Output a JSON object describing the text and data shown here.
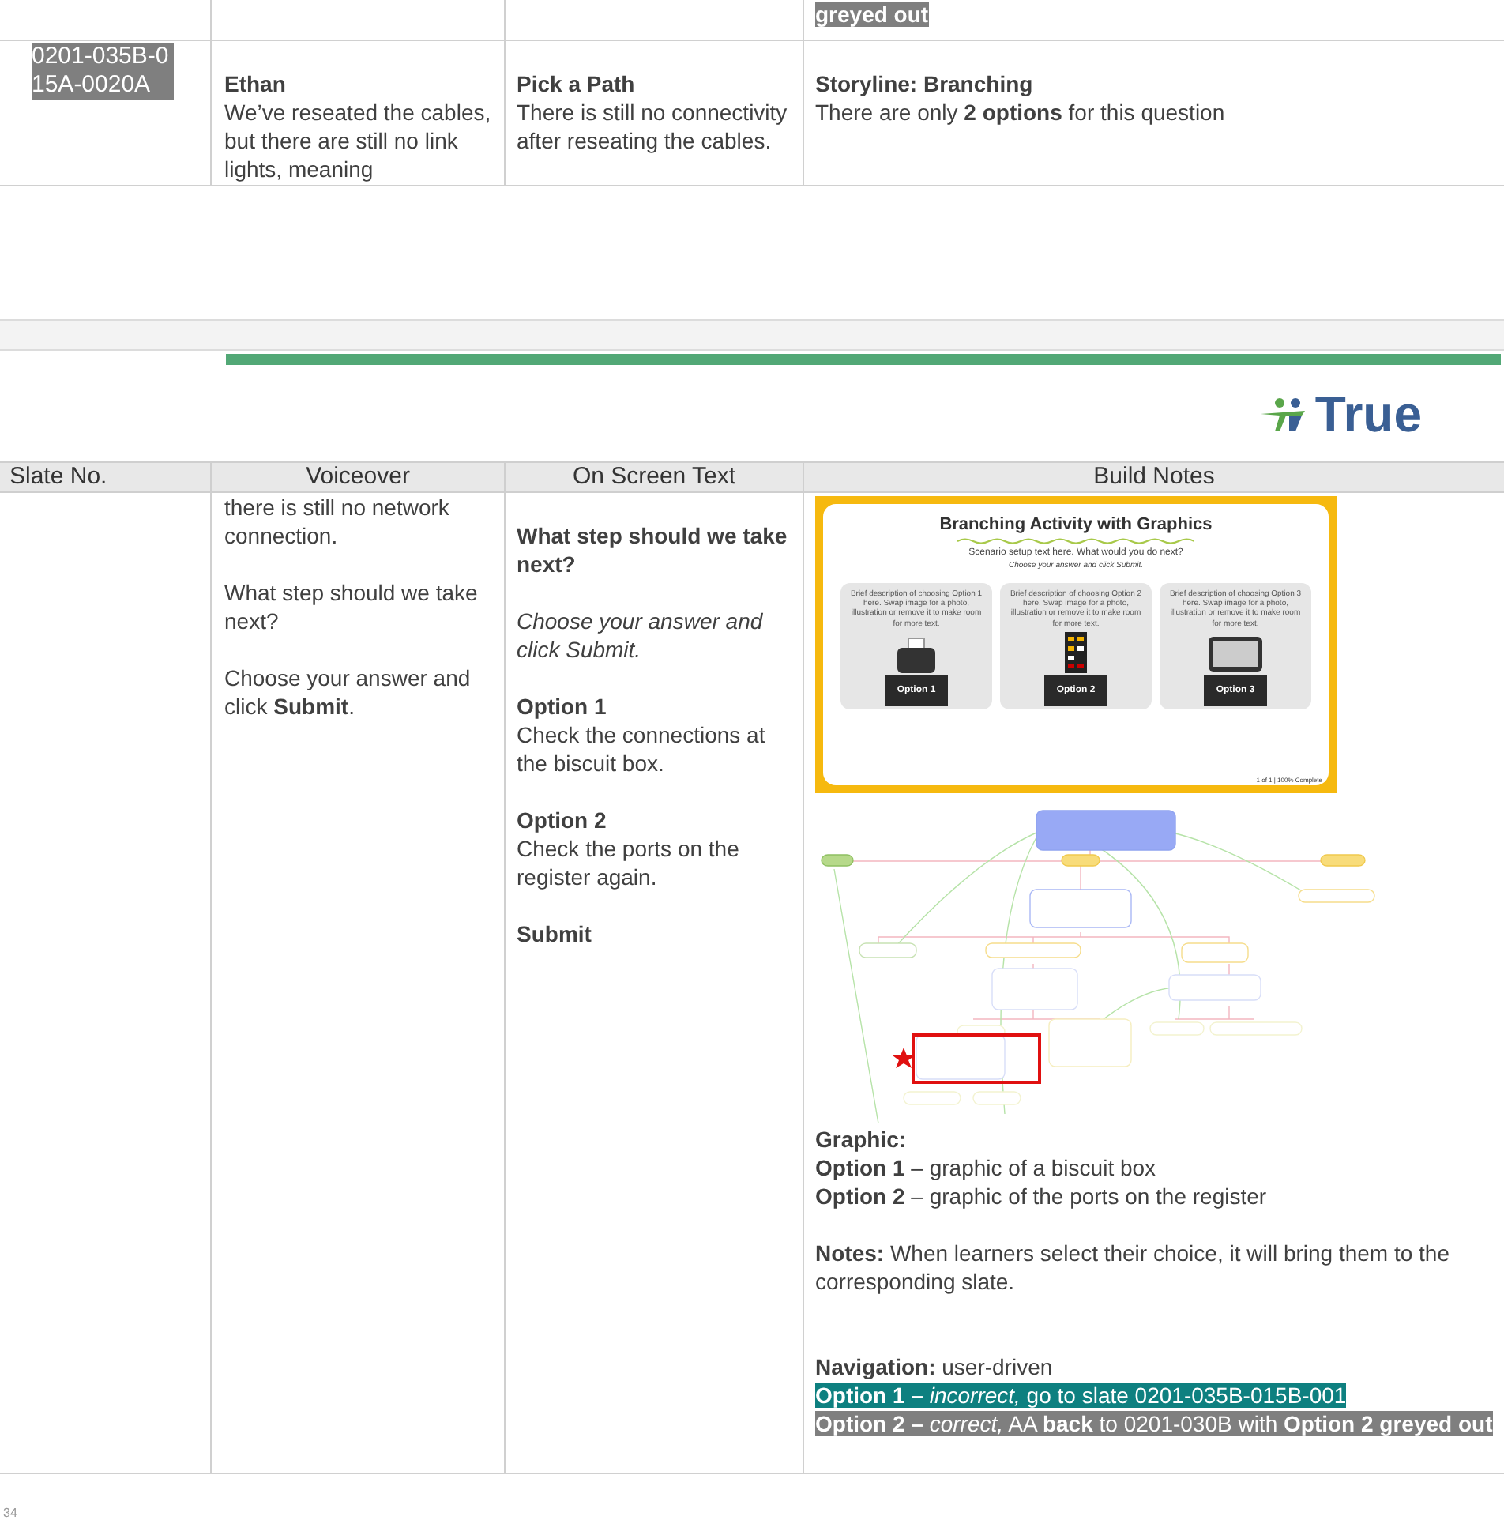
{
  "previous_row": {
    "build_notes": "greyed out"
  },
  "top_row": {
    "slate_no": "0201-035B-015A-0020A",
    "speaker": "Ethan",
    "voiceover": "We’ve reseated the cables, but there are still no link lights, meaning",
    "on_screen_title": "Pick a Path",
    "on_screen_text": "There is still no connectivity after reseating the cables.",
    "build_title": "Storyline: Branching",
    "build_text": "There are only **2 options** for this question"
  },
  "logo": {
    "text": "True"
  },
  "table": {
    "columns": [
      "Slate No.",
      "Voiceover",
      "On Screen Text",
      "Build Notes"
    ],
    "voiceover": [
      "there is still no network connection.",
      "What step should we take next?",
      "Choose your answer and click **Submit**."
    ],
    "on_screen": [
      {
        "kind": "heading",
        "text": "What step should we take next?"
      },
      {
        "kind": "instruction",
        "text": "Choose your answer and click Submit."
      },
      {
        "kind": "option",
        "title": "Option 1",
        "text": "Check the connections at the biscuit box."
      },
      {
        "kind": "option",
        "title": "Option 2",
        "text": "Check the ports on the register again."
      },
      {
        "kind": "heading",
        "text": "Submit"
      }
    ],
    "slide": {
      "title": "Branching Activity with Graphics",
      "setup": "Scenario setup text here. What would you do next?",
      "instruction": "Choose your answer and click Submit.",
      "cards": [
        {
          "description": "Brief description of choosing Option 1 here. Swap image for a photo, illustration or remove it to make room for more text.",
          "label": "Option 1",
          "kind": "printer"
        },
        {
          "description": "Brief description of choosing Option 2 here. Swap image for a photo, illustration or remove it to make room for more text.",
          "label": "Option 2",
          "kind": "panel"
        },
        {
          "description": "Brief description of choosing Option 3 here. Swap image for a photo, illustration or remove it to make room for more text.",
          "label": "Option 3",
          "kind": "tablet"
        }
      ],
      "progress": "1 of 1 | 100% Complete"
    },
    "graphic": {
      "title": "Graphic:",
      "lines": [
        "**Option 1** – graphic of a biscuit box",
        "**Option 2** – graphic of the ports on the register"
      ]
    },
    "notes": "**Notes:** When learners select their choice, it will bring them to the corresponding slate.",
    "navigation": {
      "text": "**Navigation:** user-driven",
      "lines": [
        {
          "text": "**Option 1 –** *incorrect,*   go to slate 0201-035B-015B-001",
          "color": "#0e8080"
        },
        {
          "text": "**Option 2 –** *correct,* AA **back** to 0201-030B with **Option 2 greyed out**",
          "color": "#7f7f7f"
        }
      ]
    }
  },
  "page_number": "34"
}
